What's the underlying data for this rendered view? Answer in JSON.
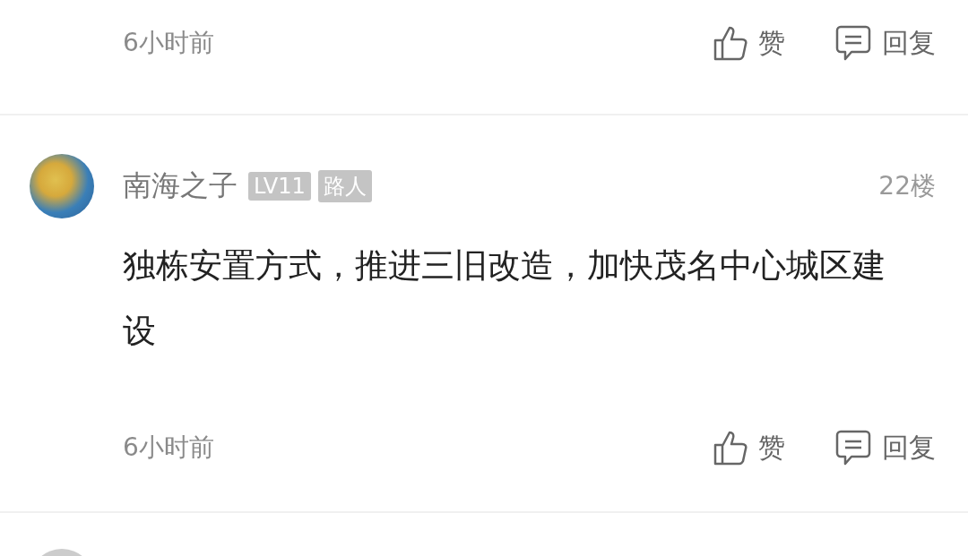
{
  "previous_comment_footer": {
    "time": "6小时前",
    "like": "赞",
    "reply": "回复"
  },
  "comments": [
    {
      "author": "南海之子",
      "badges": [
        "LV11",
        "路人"
      ],
      "floor": "22楼",
      "content": "独栋安置方式，推进三旧改造，加快茂名中心城区建设",
      "time": "6小时前",
      "like": "赞",
      "reply": "回复"
    }
  ]
}
